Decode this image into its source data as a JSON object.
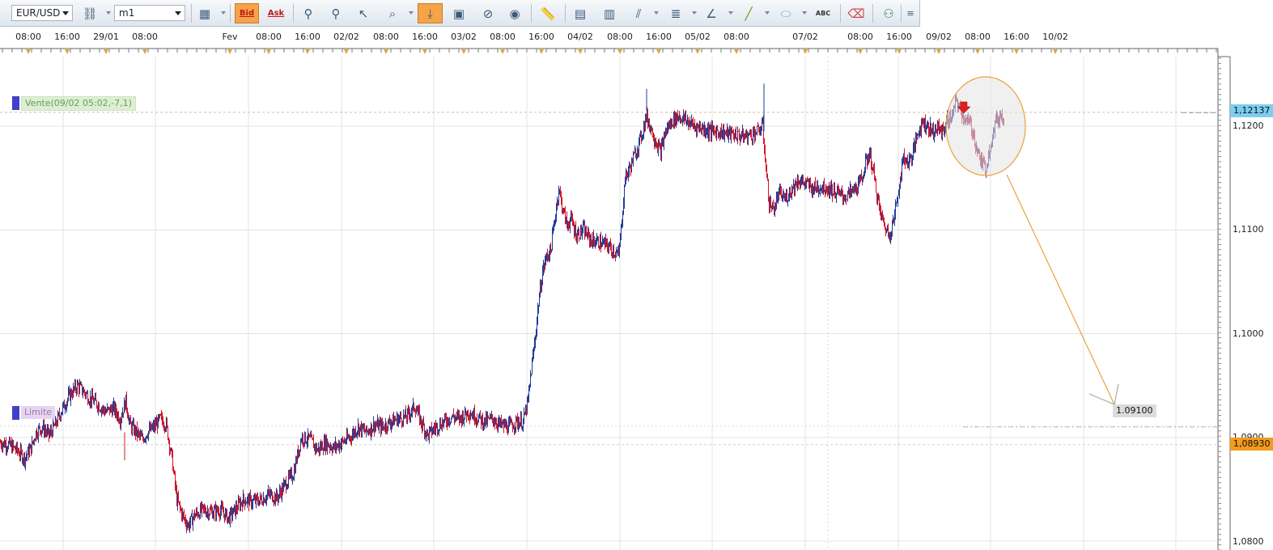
{
  "toolbar": {
    "symbol": "EUR/USD",
    "timeframe": "m1",
    "bid_label": "Bid",
    "ask_label": "Ask",
    "abc_label": "ABC",
    "icons": [
      "currency-link-icon",
      "chart-type-icon",
      "zoom-in-icon",
      "zoom-out-icon",
      "cursor-icon",
      "zoom-area-icon",
      "auto-scroll-icon",
      "template-icon",
      "crosshair-icon",
      "globe-icon",
      "ruler-icon",
      "picture-icon",
      "chart-window-icon",
      "fibonacci-icon",
      "lines-icon",
      "trendline-icon",
      "line-tool-icon",
      "ellipse-icon",
      "text-icon",
      "eraser-icon",
      "hierarchy-icon",
      "menu-icon"
    ]
  },
  "chart_data": {
    "type": "candlestick",
    "symbol": "EUR/USD",
    "timeframe": "m1",
    "x_tick_labels": [
      "08:00",
      "16:00",
      "29/01",
      "08:00",
      "Fev",
      "08:00",
      "16:00",
      "02/02",
      "08:00",
      "16:00",
      "03/02",
      "08:00",
      "16:00",
      "04/02",
      "08:00",
      "16:00",
      "05/02",
      "08:00",
      "07/02",
      "08:00",
      "16:00",
      "09/02",
      "08:00",
      "16:00",
      "10/02"
    ],
    "y_tick_labels": [
      "1,1200",
      "1,1100",
      "1,1000",
      "1,0900",
      "1,0800"
    ],
    "ylim": [
      1.079,
      1.1275
    ],
    "grid": true,
    "colors": {
      "up": "#1f3d99",
      "down": "#d41426",
      "grid": "#e3e3e3",
      "annotation": "#e8a33c"
    },
    "price_path": [
      [
        0,
        1.0895
      ],
      [
        10,
        1.0893
      ],
      [
        20,
        1.0888
      ],
      [
        30,
        1.088
      ],
      [
        38,
        1.089
      ],
      [
        44,
        1.0905
      ],
      [
        52,
        1.091
      ],
      [
        60,
        1.0902
      ],
      [
        68,
        1.0912
      ],
      [
        75,
        1.0925
      ],
      [
        85,
        1.094
      ],
      [
        95,
        1.095
      ],
      [
        102,
        1.0945
      ],
      [
        110,
        1.0938
      ],
      [
        120,
        1.0932
      ],
      [
        130,
        1.0925
      ],
      [
        140,
        1.0928
      ],
      [
        148,
        1.0918
      ],
      [
        155,
        1.0935
      ],
      [
        160,
        1.0912
      ],
      [
        168,
        1.0905
      ],
      [
        175,
        1.0898
      ],
      [
        182,
        1.0905
      ],
      [
        190,
        1.091
      ],
      [
        198,
        1.0918
      ],
      [
        205,
        1.0912
      ],
      [
        212,
        1.088
      ],
      [
        218,
        1.084
      ],
      [
        225,
        1.0825
      ],
      [
        232,
        1.0815
      ],
      [
        240,
        1.0825
      ],
      [
        250,
        1.083
      ],
      [
        262,
        1.0828
      ],
      [
        272,
        1.083
      ],
      [
        282,
        1.0822
      ],
      [
        290,
        1.083
      ],
      [
        300,
        1.084
      ],
      [
        312,
        1.0838
      ],
      [
        322,
        1.084
      ],
      [
        332,
        1.0845
      ],
      [
        342,
        1.0842
      ],
      [
        352,
        1.0855
      ],
      [
        362,
        1.0865
      ],
      [
        372,
        1.09
      ],
      [
        382,
        1.0898
      ],
      [
        392,
        1.0888
      ],
      [
        402,
        1.0895
      ],
      [
        412,
        1.089
      ],
      [
        422,
        1.0895
      ],
      [
        432,
        1.09
      ],
      [
        442,
        1.091
      ],
      [
        452,
        1.0905
      ],
      [
        462,
        1.0912
      ],
      [
        472,
        1.091
      ],
      [
        482,
        1.0915
      ],
      [
        492,
        1.0918
      ],
      [
        502,
        1.092
      ],
      [
        512,
        1.093
      ],
      [
        520,
        1.0915
      ],
      [
        528,
        1.0902
      ],
      [
        538,
        1.091
      ],
      [
        548,
        1.0915
      ],
      [
        558,
        1.092
      ],
      [
        568,
        1.0918
      ],
      [
        578,
        1.0925
      ],
      [
        588,
        1.092
      ],
      [
        598,
        1.0915
      ],
      [
        608,
        1.0918
      ],
      [
        618,
        1.0912
      ],
      [
        628,
        1.091
      ],
      [
        638,
        1.0915
      ],
      [
        646,
        1.0915
      ],
      [
        652,
        1.0935
      ],
      [
        656,
        1.0965
      ],
      [
        660,
        1.099
      ],
      [
        665,
        1.103
      ],
      [
        670,
        1.106
      ],
      [
        675,
        1.1075
      ],
      [
        680,
        1.108
      ],
      [
        685,
        1.111
      ],
      [
        690,
        1.114
      ],
      [
        695,
        1.112
      ],
      [
        700,
        1.1105
      ],
      [
        705,
        1.111
      ],
      [
        712,
        1.1095
      ],
      [
        720,
        1.11
      ],
      [
        730,
        1.109
      ],
      [
        740,
        1.1088
      ],
      [
        750,
        1.1085
      ],
      [
        758,
        1.108
      ],
      [
        764,
        1.1075
      ],
      [
        768,
        1.111
      ],
      [
        772,
        1.115
      ],
      [
        778,
        1.116
      ],
      [
        785,
        1.1175
      ],
      [
        792,
        1.119
      ],
      [
        798,
        1.121
      ],
      [
        803,
        1.12
      ],
      [
        810,
        1.1185
      ],
      [
        816,
        1.1175
      ],
      [
        822,
        1.1195
      ],
      [
        830,
        1.1205
      ],
      [
        838,
        1.121
      ],
      [
        848,
        1.1205
      ],
      [
        858,
        1.12
      ],
      [
        868,
        1.1198
      ],
      [
        878,
        1.1195
      ],
      [
        888,
        1.1195
      ],
      [
        898,
        1.1193
      ],
      [
        908,
        1.1192
      ],
      [
        918,
        1.119
      ],
      [
        928,
        1.1192
      ],
      [
        936,
        1.1195
      ],
      [
        942,
        1.12
      ],
      [
        946,
        1.116
      ],
      [
        950,
        1.1125
      ],
      [
        956,
        1.112
      ],
      [
        962,
        1.1135
      ],
      [
        970,
        1.113
      ],
      [
        978,
        1.114
      ],
      [
        986,
        1.1148
      ],
      [
        994,
        1.1145
      ],
      [
        1004,
        1.114
      ],
      [
        1014,
        1.1142
      ],
      [
        1024,
        1.114
      ],
      [
        1034,
        1.1135
      ],
      [
        1044,
        1.1132
      ],
      [
        1054,
        1.1138
      ],
      [
        1062,
        1.1145
      ],
      [
        1068,
        1.116
      ],
      [
        1074,
        1.1175
      ],
      [
        1080,
        1.115
      ],
      [
        1086,
        1.112
      ],
      [
        1092,
        1.1105
      ],
      [
        1098,
        1.1095
      ],
      [
        1104,
        1.111
      ],
      [
        1110,
        1.114
      ],
      [
        1116,
        1.117
      ],
      [
        1122,
        1.1165
      ],
      [
        1128,
        1.1175
      ],
      [
        1134,
        1.1195
      ],
      [
        1140,
        1.1205
      ],
      [
        1146,
        1.12
      ],
      [
        1152,
        1.1195
      ],
      [
        1158,
        1.1198
      ],
      [
        1164,
        1.1195
      ],
      [
        1170,
        1.1205
      ],
      [
        1176,
        1.121
      ],
      [
        1182,
        1.1225
      ],
      [
        1186,
        1.1215
      ],
      [
        1190,
        1.121
      ],
      [
        1194,
        1.1205
      ],
      [
        1200,
        1.12
      ],
      [
        1206,
        1.118
      ],
      [
        1212,
        1.1165
      ],
      [
        1218,
        1.116
      ],
      [
        1224,
        1.1185
      ],
      [
        1230,
        1.1205
      ],
      [
        1236,
        1.121
      ],
      [
        1240,
        1.1208
      ]
    ],
    "annotations": {
      "sell_order_label": "Vente(09/02 05:02,-7,1)",
      "sell_order_price": 1.12137,
      "current_price_label": "1,12137",
      "limit_label": "Limite",
      "limit_price": 1.0893,
      "limit_price_label": "1,08930",
      "target_label": "1.09100",
      "target_price": 1.091
    }
  }
}
